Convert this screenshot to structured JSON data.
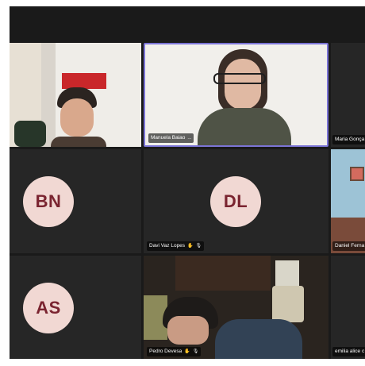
{
  "participants": [
    {
      "id": "p1",
      "name": "",
      "video": true
    },
    {
      "id": "p2",
      "name": "Manuela Baiao",
      "video": true,
      "active": true,
      "more": "..."
    },
    {
      "id": "p3",
      "name": "Maria Gonça",
      "video": false
    },
    {
      "id": "p4",
      "initials": "BN",
      "name": "",
      "video": false
    },
    {
      "id": "p5",
      "initials": "DL",
      "name": "Davi Vaz Lopes",
      "video": false
    },
    {
      "id": "p6",
      "name": "Daniel Ferna",
      "video": true
    },
    {
      "id": "p7",
      "initials": "AS",
      "name": "",
      "video": false
    },
    {
      "id": "p8",
      "name": "Pedro Devesa",
      "video": true
    },
    {
      "id": "p9",
      "name": "emilia alice c",
      "video": false
    }
  ],
  "colors": {
    "tile_bg": "#262626",
    "call_bg": "#1a1a1a",
    "active_border": "#7b74d6",
    "avatar_bg": "#f1d8d3",
    "avatar_text": "#7a2430"
  },
  "icons": [
    "raise-hand-icon",
    "mic-off-icon",
    "more-icon"
  ]
}
